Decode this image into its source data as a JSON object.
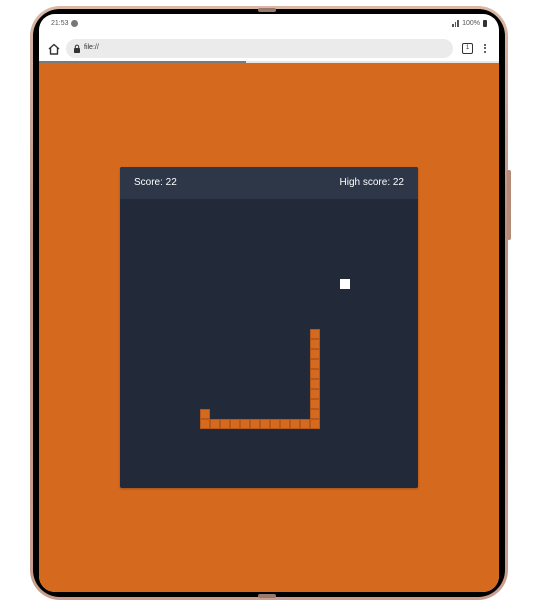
{
  "status_bar": {
    "time": "21:53",
    "battery": "100%"
  },
  "browser": {
    "url": "file://",
    "tab_count": "1",
    "load_progress": 0.45
  },
  "game": {
    "score_text": "Score: 22",
    "high_score_text": "High score: 22",
    "score": 22,
    "high_score": 22,
    "colors": {
      "page_background": "#d56a1e",
      "board": "#222938",
      "header": "#2d3748",
      "snake": "#d56a1e",
      "food": "#ffffff"
    },
    "grid_cell_units": 10,
    "food": [
      22,
      8
    ],
    "snake": [
      [
        19,
        13
      ],
      [
        19,
        14
      ],
      [
        19,
        15
      ],
      [
        19,
        16
      ],
      [
        19,
        17
      ],
      [
        19,
        18
      ],
      [
        19,
        19
      ],
      [
        19,
        20
      ],
      [
        19,
        21
      ],
      [
        19,
        22
      ],
      [
        18,
        22
      ],
      [
        17,
        22
      ],
      [
        16,
        22
      ],
      [
        15,
        22
      ],
      [
        14,
        22
      ],
      [
        13,
        22
      ],
      [
        12,
        22
      ],
      [
        11,
        22
      ],
      [
        10,
        22
      ],
      [
        9,
        22
      ],
      [
        8,
        22
      ],
      [
        8,
        21
      ]
    ]
  }
}
